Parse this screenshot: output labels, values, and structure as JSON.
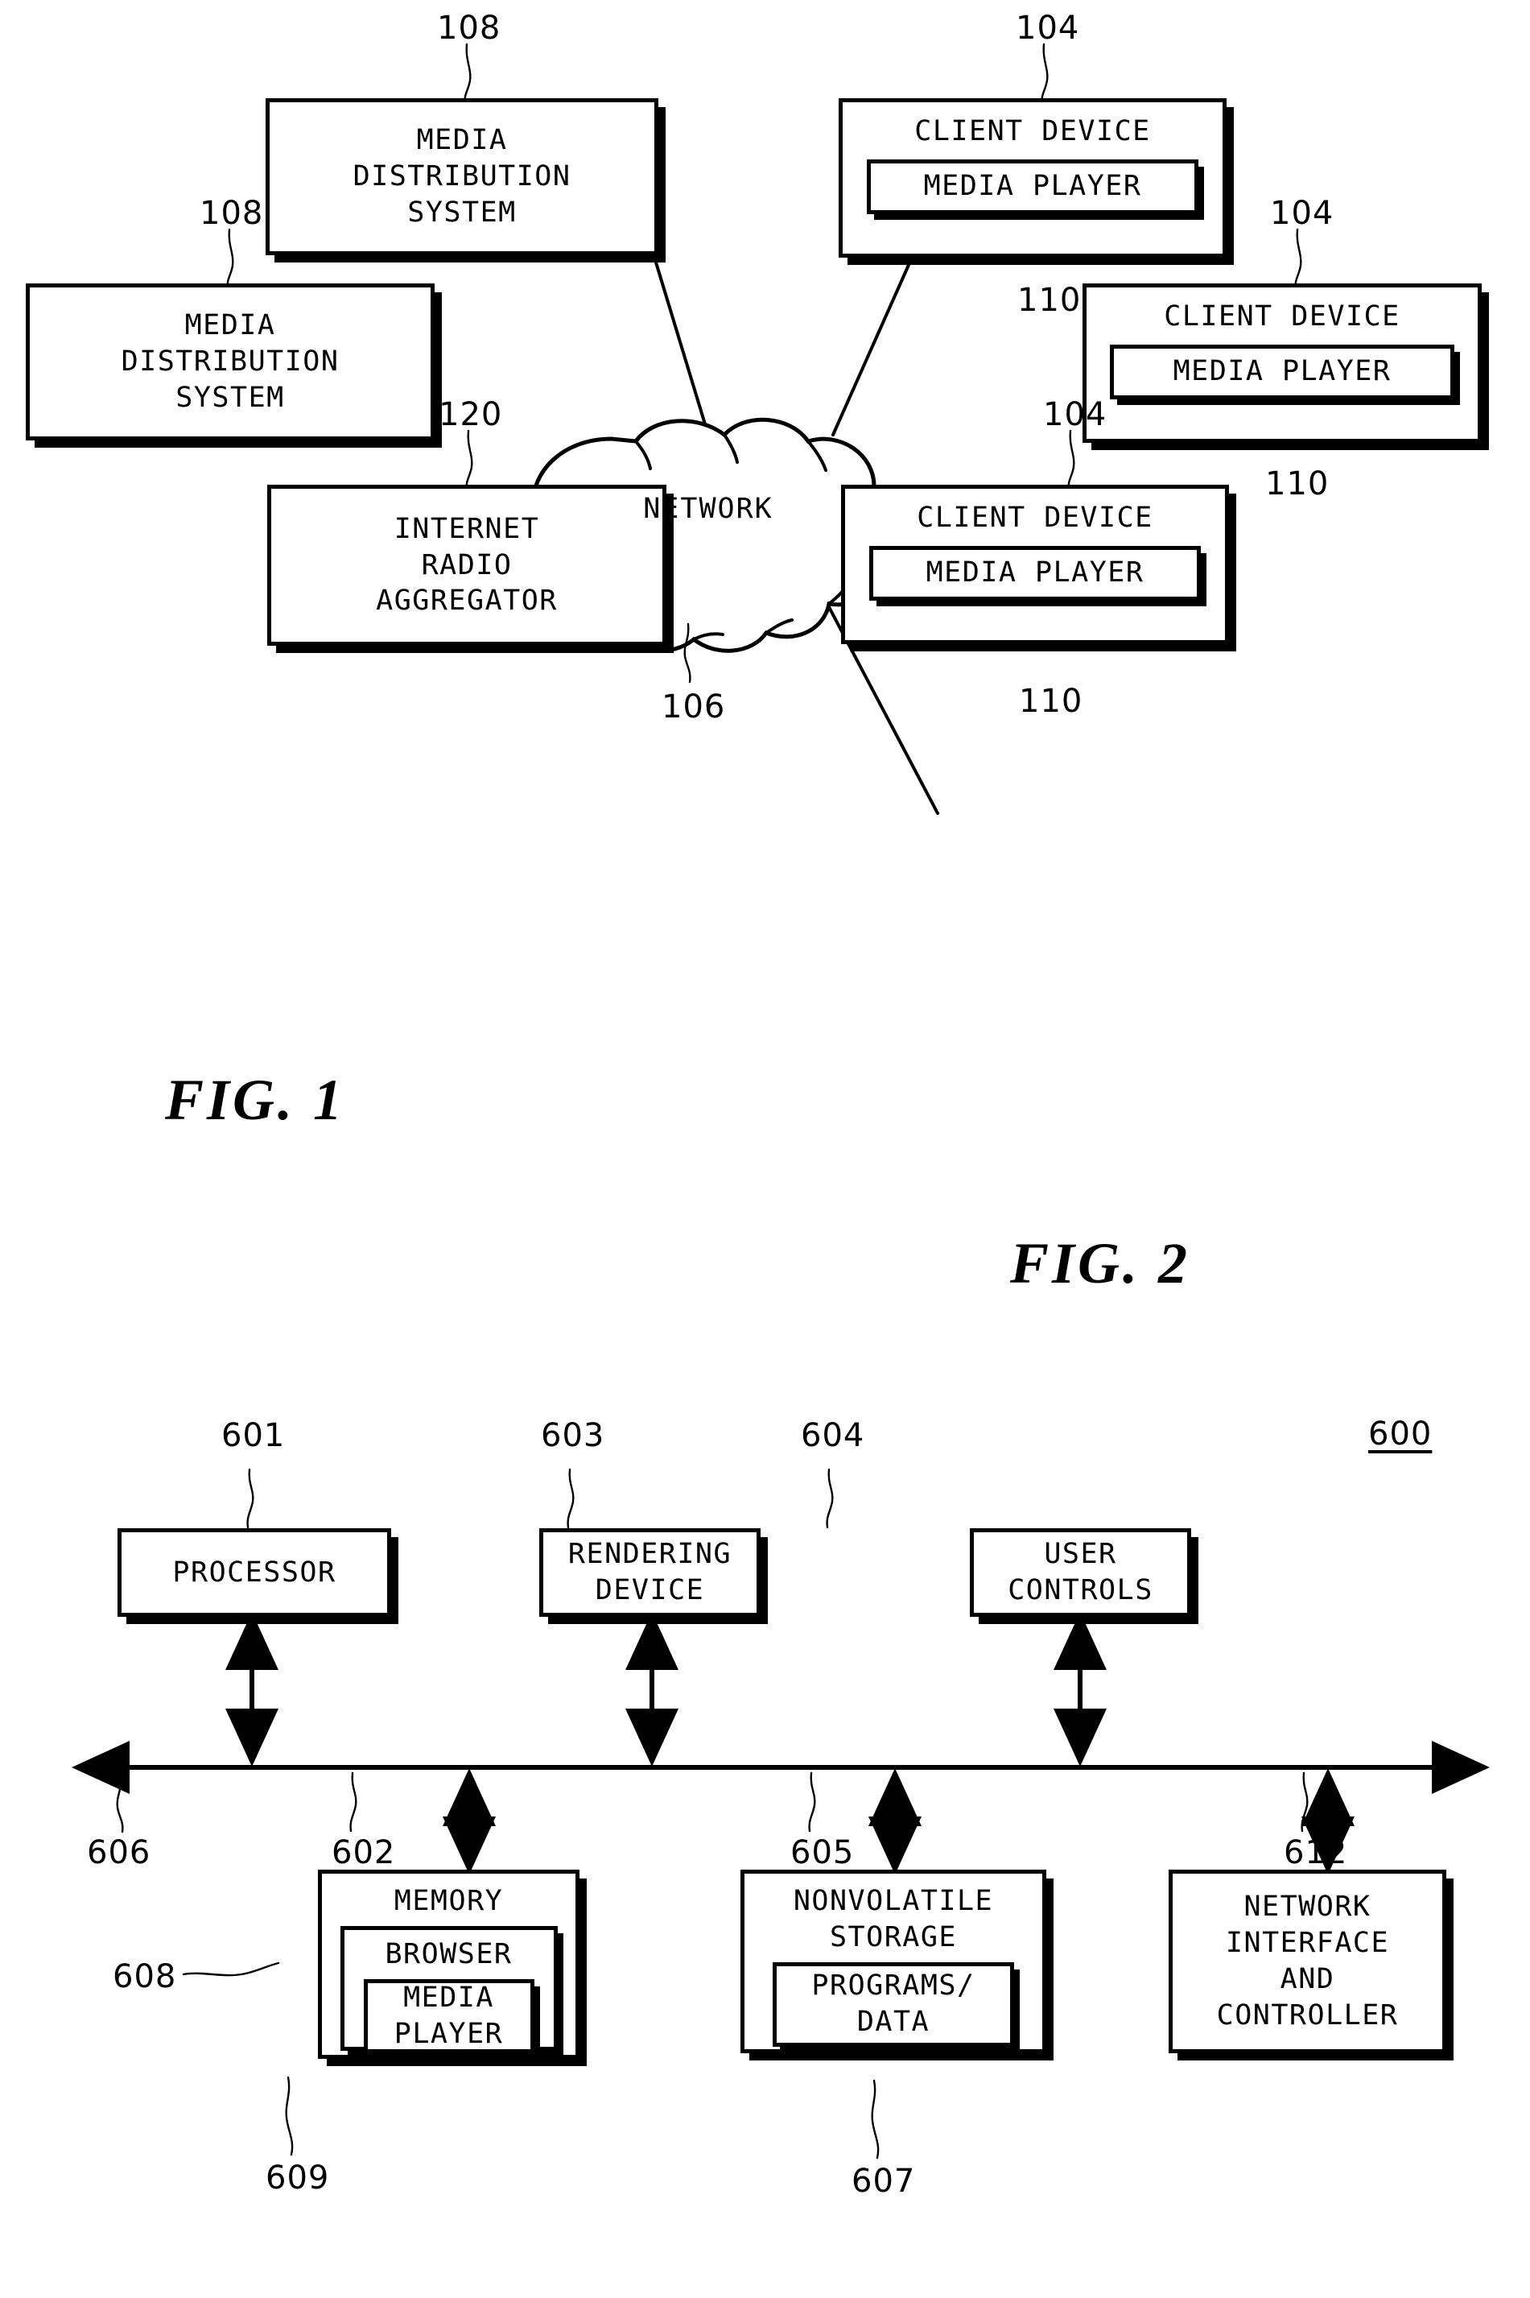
{
  "figures": [
    {
      "caption": "FIG. 1",
      "nodes": [
        {
          "id": "mds-top",
          "label_lines": [
            "MEDIA",
            "DISTRIBUTION",
            "SYSTEM"
          ],
          "ref": "108"
        },
        {
          "id": "mds-left",
          "label_lines": [
            "MEDIA",
            "DISTRIBUTION",
            "SYSTEM"
          ],
          "ref": "108"
        },
        {
          "id": "ira",
          "label_lines": [
            "INTERNET",
            "RADIO",
            "AGGREGATOR"
          ],
          "ref": "120"
        },
        {
          "id": "network",
          "label_lines": [
            "NETWORK"
          ],
          "ref": "106"
        },
        {
          "id": "client-top",
          "label_lines": [
            "CLIENT DEVICE"
          ],
          "ref": "104",
          "inner": {
            "label_lines": [
              "MEDIA PLAYER"
            ],
            "ref": "110"
          }
        },
        {
          "id": "client-mid",
          "label_lines": [
            "CLIENT DEVICE"
          ],
          "ref": "104",
          "inner": {
            "label_lines": [
              "MEDIA PLAYER"
            ],
            "ref": "110"
          }
        },
        {
          "id": "client-bot",
          "label_lines": [
            "CLIENT DEVICE"
          ],
          "ref": "104",
          "inner": {
            "label_lines": [
              "MEDIA PLAYER"
            ],
            "ref": "110"
          }
        }
      ]
    },
    {
      "caption": "FIG. 2",
      "system_ref": "600",
      "bus_ref": "606",
      "nodes": [
        {
          "id": "processor",
          "label_lines": [
            "PROCESSOR"
          ],
          "ref": "601"
        },
        {
          "id": "rendering",
          "label_lines": [
            "RENDERING",
            "DEVICE"
          ],
          "ref": "603"
        },
        {
          "id": "usercontrols",
          "label_lines": [
            "USER",
            "CONTROLS"
          ],
          "ref": "604"
        },
        {
          "id": "memory",
          "label_lines": [
            "MEMORY"
          ],
          "ref": "602",
          "inner": {
            "label_lines": [
              "BROWSER"
            ],
            "ref": "608",
            "inner": {
              "label_lines": [
                "MEDIA",
                "PLAYER"
              ],
              "ref": "609"
            }
          }
        },
        {
          "id": "nvstorage",
          "label_lines": [
            "NONVOLATILE",
            "STORAGE"
          ],
          "ref": "605",
          "inner": {
            "label_lines": [
              "PROGRAMS/",
              "DATA"
            ],
            "ref": "607"
          }
        },
        {
          "id": "netiface",
          "label_lines": [
            "NETWORK",
            "INTERFACE",
            "AND",
            "CONTROLLER"
          ],
          "ref": "612"
        }
      ]
    }
  ],
  "fig1": {
    "mds_top": {
      "l1": "MEDIA",
      "l2": "DISTRIBUTION",
      "l3": "SYSTEM",
      "ref": "108"
    },
    "mds_left": {
      "l1": "MEDIA",
      "l2": "DISTRIBUTION",
      "l3": "SYSTEM",
      "ref": "108"
    },
    "ira": {
      "l1": "INTERNET",
      "l2": "RADIO",
      "l3": "AGGREGATOR",
      "ref": "120"
    },
    "network": {
      "label": "NETWORK",
      "ref": "106"
    },
    "client_top": {
      "label": "CLIENT DEVICE",
      "ref": "104",
      "player": "MEDIA PLAYER",
      "player_ref": "110"
    },
    "client_mid": {
      "label": "CLIENT DEVICE",
      "ref": "104",
      "player": "MEDIA PLAYER",
      "player_ref": "110"
    },
    "client_bot": {
      "label": "CLIENT DEVICE",
      "ref": "104",
      "player": "MEDIA PLAYER",
      "player_ref": "110"
    },
    "caption": "FIG. 1"
  },
  "fig2": {
    "caption": "FIG. 2",
    "system_ref": "600",
    "bus_ref": "606",
    "processor": {
      "label": "PROCESSOR",
      "ref": "601"
    },
    "rendering": {
      "l1": "RENDERING",
      "l2": "DEVICE",
      "ref": "603"
    },
    "usercontrols": {
      "l1": "USER",
      "l2": "CONTROLS",
      "ref": "604"
    },
    "memory": {
      "label": "MEMORY",
      "ref": "602",
      "browser": {
        "label": "BROWSER",
        "ref": "608"
      },
      "player": {
        "l1": "MEDIA",
        "l2": "PLAYER",
        "ref": "609"
      }
    },
    "nvstorage": {
      "l1": "NONVOLATILE",
      "l2": "STORAGE",
      "ref": "605",
      "programs": {
        "l1": "PROGRAMS/",
        "l2": "DATA",
        "ref": "607"
      }
    },
    "netiface": {
      "l1": "NETWORK",
      "l2": "INTERFACE",
      "l3": "AND",
      "l4": "CONTROLLER",
      "ref": "612"
    }
  }
}
